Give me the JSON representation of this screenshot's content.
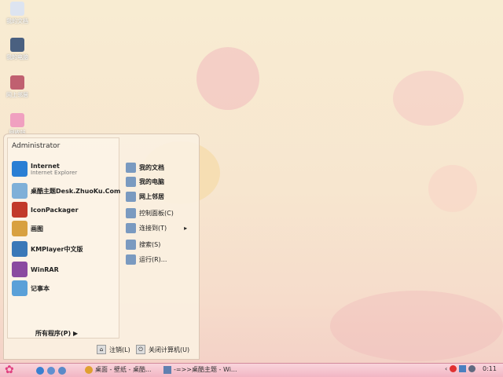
{
  "desktop": {
    "icons": [
      {
        "label": "我的文档",
        "icon": "my-documents-icon"
      },
      {
        "label": "我的电脑",
        "icon": "my-computer-icon"
      },
      {
        "label": "网上邻居",
        "icon": "network-icon"
      },
      {
        "label": "回收站",
        "icon": "recycle-bin-icon"
      }
    ]
  },
  "start_menu": {
    "user": "Administrator",
    "left_items": [
      {
        "label": "Internet",
        "sub": "Internet Explorer",
        "icon": "ie-icon",
        "color": "#2a7fd4"
      },
      {
        "label": "桌酷主题Desk.ZhuoKu.Com",
        "icon": "zhuoku-icon",
        "color": "#7fb0d8"
      },
      {
        "label": "IconPackager",
        "icon": "iconpackager-icon",
        "color": "#c23a2a"
      },
      {
        "label": "画图",
        "icon": "paint-icon",
        "color": "#d8a040"
      },
      {
        "label": "KMPlayer中文版",
        "icon": "kmplayer-icon",
        "color": "#3a78b8"
      },
      {
        "label": "WinRAR",
        "icon": "winrar-icon",
        "color": "#8a4aa0"
      },
      {
        "label": "记事本",
        "icon": "notepad-icon",
        "color": "#5aa0d8"
      }
    ],
    "right_items": [
      {
        "label": "我的文档",
        "icon": "my-documents-icon",
        "bold": true
      },
      {
        "label": "我的电脑",
        "icon": "my-computer-icon",
        "bold": true
      },
      {
        "label": "网上邻居",
        "icon": "network-icon",
        "bold": true
      },
      {
        "label": "控制面板(C)",
        "icon": "control-panel-icon"
      },
      {
        "label": "连接到(T)",
        "icon": "connect-icon"
      },
      {
        "label": "搜索(S)",
        "icon": "search-icon"
      },
      {
        "label": "运行(R)...",
        "icon": "run-icon"
      }
    ],
    "all_programs": "所有程序(P)",
    "logoff": "注销(L)",
    "shutdown": "关闭计算机(U)"
  },
  "taskbar": {
    "tasks": [
      {
        "label": "桌面 - 壁纸 - 桌酷...",
        "icon": "chrome-icon"
      },
      {
        "label": "-=>>桌酷主题 - Wi...",
        "icon": "window-icon"
      }
    ],
    "clock": "0:11",
    "tray_toggle": "‹"
  }
}
